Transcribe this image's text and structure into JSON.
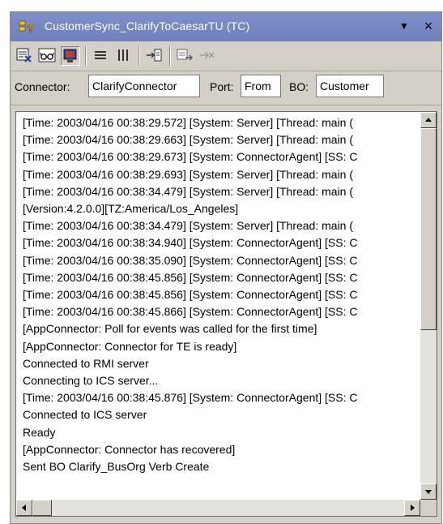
{
  "window": {
    "title": "CustomerSync_ClarifyToCaesarTU (TC)",
    "menu_glyph": "▼",
    "close_glyph": "×"
  },
  "fields": {
    "connector_label": "Connector:",
    "connector_value": "ClarifyConnector",
    "port_label": "Port:",
    "port_value": "From",
    "bo_label": "BO:",
    "bo_value": "Customer"
  },
  "log": {
    "lines": [
      "[Time: 2003/04/16 00:38:29.572] [System: Server] [Thread: main (",
      "[Time: 2003/04/16 00:38:29.663] [System: Server] [Thread: main (",
      "[Time: 2003/04/16 00:38:29.673] [System: ConnectorAgent] [SS: C",
      "[Time: 2003/04/16 00:38:29.693] [System: Server] [Thread: main (",
      "[Time: 2003/04/16 00:38:34.479] [System: Server] [Thread: main (",
      "[Version:4.2.0.0][TZ:America/Los_Angeles]",
      "[Time: 2003/04/16 00:38:34.479] [System: Server] [Thread: main (",
      "[Time: 2003/04/16 00:38:34.940] [System: ConnectorAgent] [SS: C",
      "[Time: 2003/04/16 00:38:35.090] [System: ConnectorAgent] [SS: C",
      "[Time: 2003/04/16 00:38:45.856] [System: ConnectorAgent] [SS: C",
      "[Time: 2003/04/16 00:38:45.856] [System: ConnectorAgent] [SS: C",
      "[Time: 2003/04/16 00:38:45.866] [System: ConnectorAgent] [SS: C",
      "[AppConnector: Poll for events was called for the first time]",
      "[AppConnector: Connector for TE is ready]",
      "Connected to RMI server",
      "Connecting to ICS server...",
      "[Time: 2003/04/16 00:38:45.876] [System: ConnectorAgent] [SS: C",
      "Connected to ICS server",
      "Ready",
      "[AppConnector: Connector has recovered]",
      "Sent BO Clarify_BusOrg Verb Create"
    ],
    "vertical_scroll_fraction": 0.0,
    "horizontal_scroll_fraction": 0.0
  },
  "toolbar": {
    "icons": [
      "trace-settings-icon",
      "glasses-view-icon",
      "monitor-icon",
      "horizontal-layout-icon",
      "vertical-layout-icon",
      "import-icon",
      "send-bo-icon",
      "disabled-action-icon"
    ]
  },
  "colors": {
    "titlebar": "#7382c2",
    "chrome": "#d4d0c8",
    "field_background": "#ffffff"
  }
}
